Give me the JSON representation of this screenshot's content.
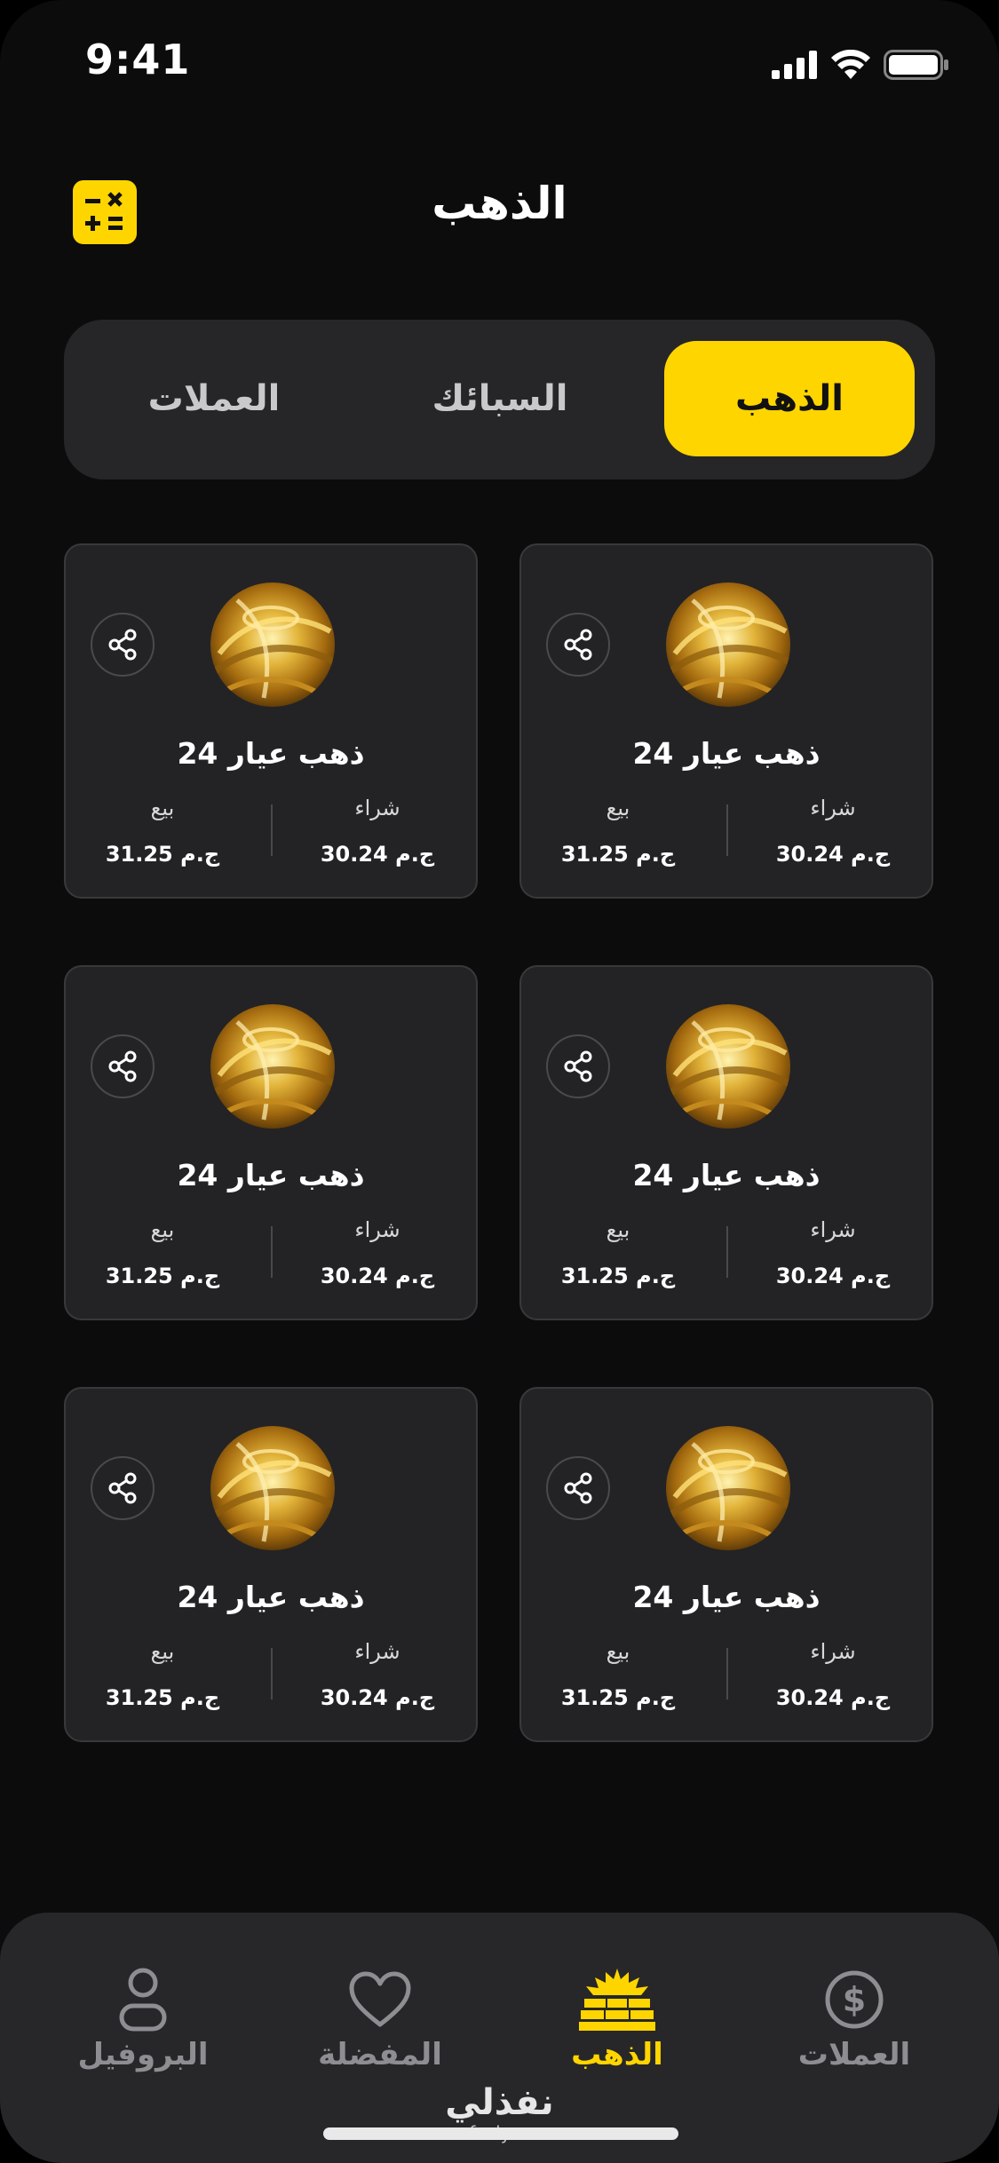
{
  "status_bar": {
    "time": "9:41",
    "signal_icon": "cellular-signal-icon",
    "wifi_icon": "wifi-icon",
    "battery_icon": "battery-icon"
  },
  "header": {
    "title": "الذهب",
    "calculator_icon": "calculator-icon"
  },
  "tabs": [
    {
      "label": "الذهب",
      "active": true
    },
    {
      "label": "السبائك",
      "active": false
    },
    {
      "label": "العملات",
      "active": false
    }
  ],
  "cards": [
    {
      "title": "ذهب عيار 24",
      "buy_label": "شراء",
      "buy_value": "30.24 ج.م",
      "sell_label": "بيع",
      "sell_value": "31.25 ج.م"
    },
    {
      "title": "ذهب عيار 24",
      "buy_label": "شراء",
      "buy_value": "30.24 ج.م",
      "sell_label": "بيع",
      "sell_value": "31.25 ج.م"
    },
    {
      "title": "ذهب عيار 24",
      "buy_label": "شراء",
      "buy_value": "30.24 ج.م",
      "sell_label": "بيع",
      "sell_value": "31.25 ج.م"
    },
    {
      "title": "ذهب عيار 24",
      "buy_label": "شراء",
      "buy_value": "30.24 ج.م",
      "sell_label": "بيع",
      "sell_value": "31.25 ج.م"
    },
    {
      "title": "ذهب عيار 24",
      "buy_label": "شراء",
      "buy_value": "30.24 ج.م",
      "sell_label": "بيع",
      "sell_value": "31.25 ج.م"
    },
    {
      "title": "ذهب عيار 24",
      "buy_label": "شراء",
      "buy_value": "30.24 ج.م",
      "sell_label": "بيع",
      "sell_value": "31.25 ج.م"
    }
  ],
  "bottom_nav": [
    {
      "label": "العملات",
      "icon": "dollar-coin-icon",
      "active": false
    },
    {
      "label": "الذهب",
      "icon": "gold-bars-icon",
      "active": true
    },
    {
      "label": "المفضلة",
      "icon": "heart-icon",
      "active": false
    },
    {
      "label": "البروفيل",
      "icon": "user-icon",
      "active": false
    }
  ],
  "watermark": {
    "logo_text": "نفذلي",
    "url": "nafezly.com"
  },
  "colors": {
    "accent": "#ffd500",
    "background": "#0c0c0d",
    "card": "#232325",
    "inactive": "#8e8e92"
  }
}
